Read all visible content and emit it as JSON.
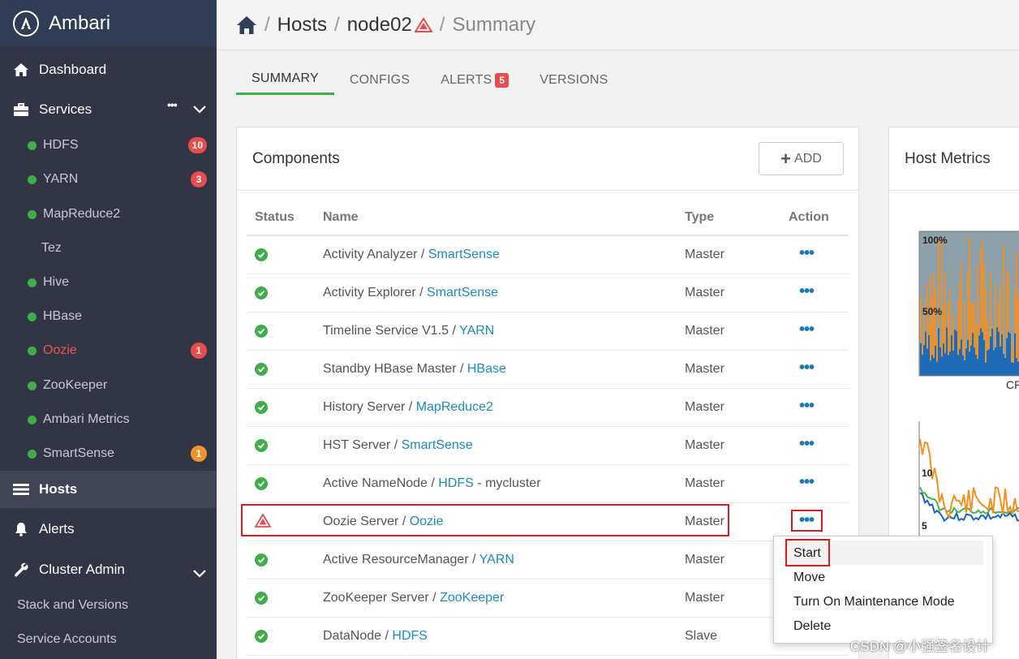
{
  "app": {
    "name": "Ambari"
  },
  "sidebar": {
    "dashboard": "Dashboard",
    "services": "Services",
    "services_more": "•••",
    "service_items": [
      {
        "label": "HDFS",
        "badge": "10",
        "status": "green"
      },
      {
        "label": "YARN",
        "badge": "3",
        "status": "green"
      },
      {
        "label": "MapReduce2",
        "badge": "",
        "status": "green"
      },
      {
        "label": "Tez",
        "badge": "",
        "status": "none"
      },
      {
        "label": "Hive",
        "badge": "",
        "status": "green"
      },
      {
        "label": "HBase",
        "badge": "",
        "status": "green"
      },
      {
        "label": "Oozie",
        "badge": "1",
        "status": "alert"
      },
      {
        "label": "ZooKeeper",
        "badge": "",
        "status": "green"
      },
      {
        "label": "Ambari Metrics",
        "badge": "",
        "status": "green"
      },
      {
        "label": "SmartSense",
        "badge": "1",
        "status": "green"
      }
    ],
    "hosts": "Hosts",
    "alerts": "Alerts",
    "cluster_admin": "Cluster Admin",
    "stack_versions": "Stack and Versions",
    "service_accounts": "Service Accounts"
  },
  "breadcrumb": {
    "hosts": "Hosts",
    "host": "node02",
    "page": "Summary",
    "sep": "/"
  },
  "tabs": {
    "summary": "SUMMARY",
    "configs": "CONFIGS",
    "alerts": "ALERTS",
    "alerts_count": "5",
    "versions": "VERSIONS"
  },
  "components": {
    "title": "Components",
    "add_label": "ADD",
    "headers": {
      "status": "Status",
      "name": "Name",
      "type": "Type",
      "action": "Action"
    },
    "rows": [
      {
        "name": "Activity Analyzer / ",
        "service": "SmartSense",
        "suffix": "",
        "type": "Master",
        "status": "ok"
      },
      {
        "name": "Activity Explorer / ",
        "service": "SmartSense",
        "suffix": "",
        "type": "Master",
        "status": "ok"
      },
      {
        "name": "Timeline Service V1.5 / ",
        "service": "YARN",
        "suffix": "",
        "type": "Master",
        "status": "ok"
      },
      {
        "name": "Standby HBase Master / ",
        "service": "HBase",
        "suffix": "",
        "type": "Master",
        "status": "ok"
      },
      {
        "name": "History Server / ",
        "service": "MapReduce2",
        "suffix": "",
        "type": "Master",
        "status": "ok"
      },
      {
        "name": "HST Server / ",
        "service": "SmartSense",
        "suffix": "",
        "type": "Master",
        "status": "ok"
      },
      {
        "name": "Active NameNode / ",
        "service": "HDFS",
        "suffix": " - mycluster",
        "type": "Master",
        "status": "ok"
      },
      {
        "name": "Oozie Server / ",
        "service": "Oozie",
        "suffix": "",
        "type": "Master",
        "status": "alert"
      },
      {
        "name": "Active ResourceManager / ",
        "service": "YARN",
        "suffix": "",
        "type": "Master",
        "status": "ok"
      },
      {
        "name": "ZooKeeper Server / ",
        "service": "ZooKeeper",
        "suffix": "",
        "type": "Master",
        "status": "ok"
      },
      {
        "name": "DataNode / ",
        "service": "HDFS",
        "suffix": "",
        "type": "Slave",
        "status": "ok"
      }
    ],
    "action_label": "•••"
  },
  "action_menu": {
    "items": [
      "Start",
      "Move",
      "Turn On Maintenance Mode",
      "Delete"
    ]
  },
  "host_metrics": {
    "title": "Host Metrics",
    "cpu_labels": [
      "100%",
      "50%"
    ],
    "cpu_caption": "CP",
    "load_labels": [
      "10",
      "5"
    ]
  },
  "watermark": "CSDN @小强签名设计",
  "colors": {
    "accent": "#3fae49",
    "alert": "#e94c4c",
    "link": "#1a8bc4",
    "sidebar": "#323544"
  }
}
